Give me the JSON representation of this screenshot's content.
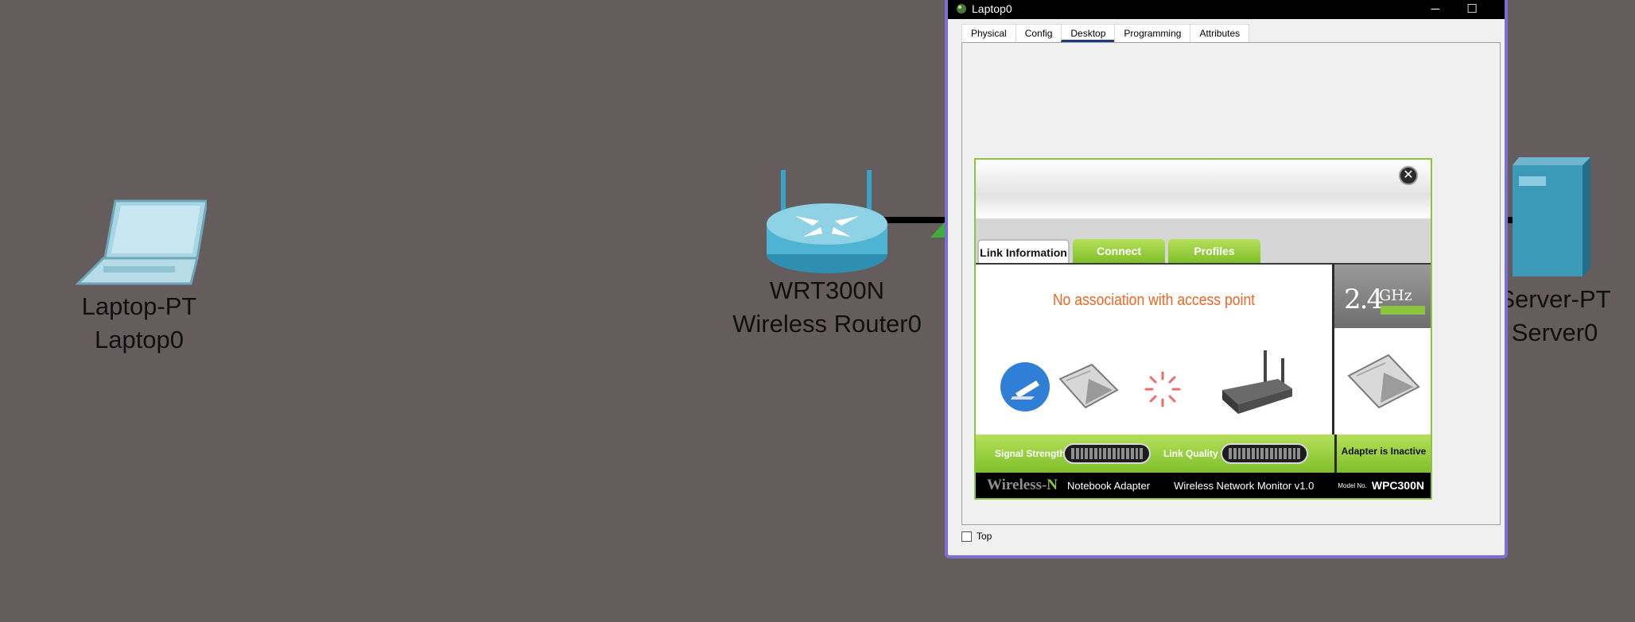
{
  "canvas": {
    "devices": [
      {
        "type": "Laptop-PT",
        "name": "Laptop0"
      },
      {
        "type": "WRT300N",
        "name": "Wireless Router0"
      },
      {
        "type": "Server-PT",
        "name": "Server0"
      }
    ]
  },
  "window": {
    "title": "Laptop0",
    "controls": {
      "minimize": "─",
      "maximize": "☐",
      "close": "✕"
    },
    "tabs": [
      {
        "label": "Physical"
      },
      {
        "label": "Config"
      },
      {
        "label": "Desktop",
        "active": true
      },
      {
        "label": "Programming"
      },
      {
        "label": "Attributes"
      }
    ],
    "top_checkbox": {
      "label": "Top",
      "checked": false
    }
  },
  "monitor": {
    "close_glyph": "✕",
    "tabs": [
      {
        "label": "Link Information",
        "active": true
      },
      {
        "label": "Connect"
      },
      {
        "label": "Profiles"
      }
    ],
    "status_message": "No association with access point",
    "band": {
      "value": "2.4",
      "unit": "GHz"
    },
    "signal_strength_label": "Signal Strength",
    "link_quality_label": "Link Quality",
    "adapter_state": "Adapter is Inactive",
    "footer": {
      "brand_prefix": "Wireless-",
      "brand_suffix": "N",
      "product": "Notebook Adapter",
      "app_name": "Wireless Network Monitor  v1.0",
      "model_label": "Model No.",
      "model_number": "WPC300N"
    }
  },
  "colors": {
    "canvas_bg": "#655c5e",
    "window_border": "#7b6fd4",
    "accent_green": "#8cc63f",
    "status_orange": "#f26522"
  }
}
